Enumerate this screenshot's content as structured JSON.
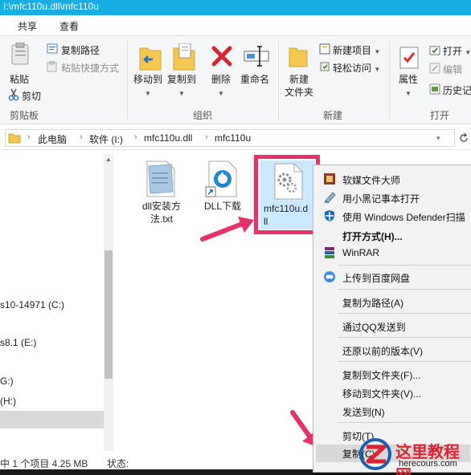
{
  "window": {
    "title": "I:\\mfc110u.dll\\mfc110u"
  },
  "ribbon": {
    "tabs": [
      "共享",
      "查看"
    ],
    "clipboard": {
      "paste_label": "粘贴",
      "copy_path_label": "复制路径",
      "paste_shortcut_label": "粘贴快捷方式",
      "cut_label": "剪切",
      "group_label": "剪贴板"
    },
    "organize": {
      "move_to_label": "移动到",
      "copy_to_label": "复制到",
      "delete_label": "删除",
      "rename_label": "重命名",
      "group_label": "组织"
    },
    "new": {
      "new_folder_label_1": "新建",
      "new_folder_label_2": "文件夹",
      "new_item_label": "新建项目",
      "easy_access_label": "轻松访问",
      "group_label": "新建"
    },
    "open": {
      "properties_label": "属性",
      "open_label": "打开",
      "edit_label": "编辑",
      "history_label": "历史记",
      "group_label": "打开"
    }
  },
  "address": {
    "crumbs": [
      "此电脑",
      "软件 (I:)",
      "mfc110u.dll",
      "mfc110u"
    ]
  },
  "nav": {
    "items": [
      "s10-14971 (C:)",
      "s8.1 (E:)",
      "G:)",
      "(H:)"
    ]
  },
  "files": [
    {
      "name_line1": "dll安装方",
      "name_line2": "法.txt",
      "icon": "text-file-icon"
    },
    {
      "name_line1": "DLL下载",
      "name_line2": "",
      "icon": "shortcut-icon"
    },
    {
      "name_line1": "mfc110u.d",
      "name_line2": "ll",
      "icon": "dll-file-icon"
    }
  ],
  "status": {
    "selection": "中 1 个项目  4.25 MB",
    "state_label": "状态:"
  },
  "context_menu": {
    "items": [
      "软媒文件大师",
      "用小黑记事本打开",
      "使用 Windows Defender扫描",
      "打开方式(H)...",
      "WinRAR",
      "上传到百度网盘",
      "复制为路径(A)",
      "通过QQ发送到",
      "还原以前的版本(V)",
      "复制到文件夹(F)...",
      "移动到文件夹(V)...",
      "发送到(N)",
      "剪切(T)",
      "复制(C)"
    ]
  },
  "watermark": {
    "title": "这里教程网",
    "url": "herecours.com"
  },
  "colors": {
    "titlebar": "#19aee3",
    "highlight": "#e8306b",
    "watermark_red": "#e02231"
  }
}
